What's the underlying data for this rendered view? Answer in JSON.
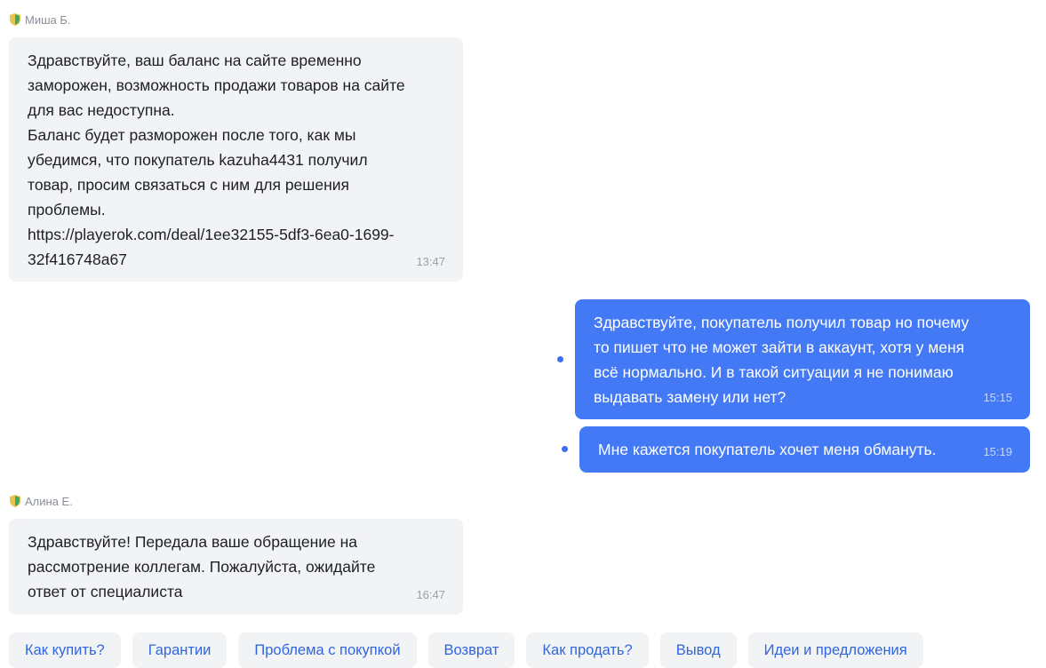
{
  "messages": [
    {
      "sender": "Миша Б.",
      "direction": "in",
      "text": "Здравствуйте, ваш баланс на сайте временно\nзаморожен, возможность продажи товаров на сайте\nдля вас недоступна.\nБаланс будет разморожен после того, как мы\nубедимся, что покупатель kazuha4431 получил\nтовар, просим связаться с ним для решения\nпроблемы.\nhttps://playerok.com/deal/1ee32155-5df3-6ea0-1699-\n32f416748a67",
      "time": "13:47"
    },
    {
      "direction": "out",
      "text": "Здравствуйте, покупатель получил товар но почему\nто пишет что не может зайти в аккаунт, хотя у меня\nвсё нормально. И в такой ситуации я не понимаю\nвыдавать замену или нет?",
      "time": "15:15"
    },
    {
      "direction": "out",
      "text": "Мне кажется покупатель хочет меня обмануть.",
      "time": "15:19"
    },
    {
      "sender": "Алина Е.",
      "direction": "in",
      "text": "Здравствуйте! Передала ваше обращение на\nрассмотрение коллегам. Пожалуйста, ожидайте\nответ от специалиста",
      "time": "16:47"
    }
  ],
  "quick_replies": [
    "Как купить?",
    "Гарантии",
    "Проблема с покупкой",
    "Возврат",
    "Как продать?",
    "Вывод",
    "Идеи и предложения"
  ],
  "colors": {
    "outgoing_bubble": "#4479f5",
    "incoming_bubble": "#f2f3f5",
    "link_accent": "#2f66e0",
    "unread_dot": "#3b6ff0"
  },
  "icons": {
    "sender_badge": "support-shield-icon"
  }
}
